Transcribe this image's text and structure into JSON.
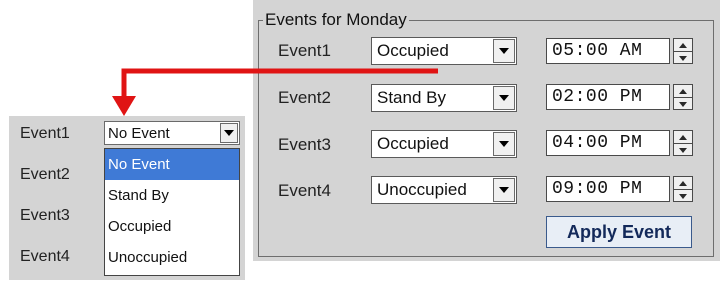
{
  "colors": {
    "panel_bg": "#d4d4d4",
    "arrow": "#e01414",
    "selection": "#3f7ad6",
    "apply_text": "#13295a"
  },
  "group": {
    "title": "Events for Monday",
    "rows": [
      {
        "label": "Event1",
        "type": "Occupied",
        "time": "05:00 AM"
      },
      {
        "label": "Event2",
        "type": "Stand By",
        "time": "02:00 PM"
      },
      {
        "label": "Event3",
        "type": "Occupied",
        "time": "04:00 PM"
      },
      {
        "label": "Event4",
        "type": "Unoccupied",
        "time": "09:00 PM"
      }
    ],
    "apply_label": "Apply Event"
  },
  "zoom_panel": {
    "labels": [
      "Event1",
      "Event2",
      "Event3",
      "Event4"
    ],
    "selected_value": "No Event",
    "options": [
      "No Event",
      "Stand By",
      "Occupied",
      "Unoccupied"
    ],
    "highlighted_option": "No Event"
  },
  "icons": {
    "dropdown": "triangle-down-icon",
    "spin_up": "triangle-up-icon",
    "spin_down": "triangle-down-icon",
    "callout": "red-arrow"
  }
}
